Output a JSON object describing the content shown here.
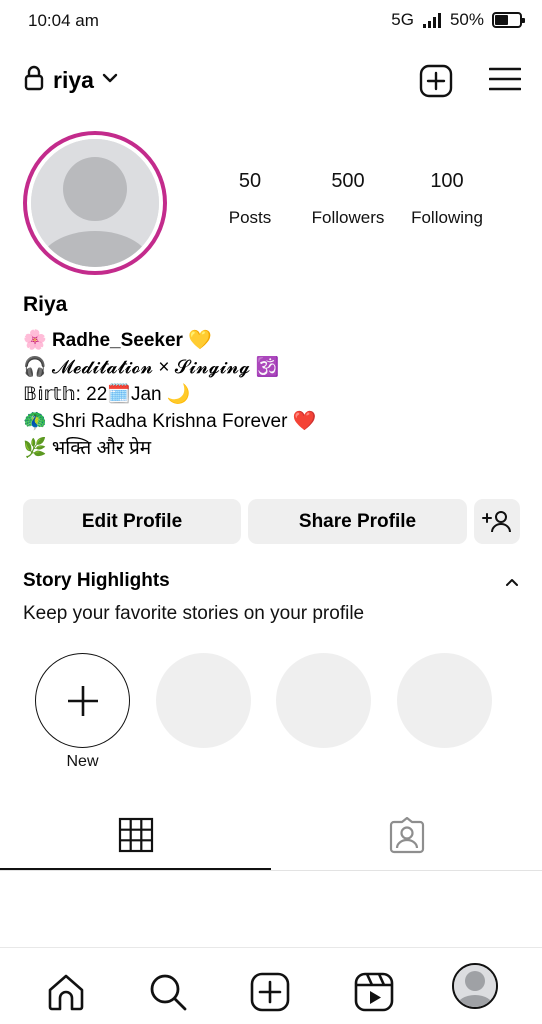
{
  "status_bar": {
    "time": "10:04 am",
    "network": "5G",
    "battery": "50%"
  },
  "header": {
    "username": "riya"
  },
  "profile": {
    "stats": [
      {
        "value": "50",
        "label": "Posts"
      },
      {
        "value": "500",
        "label": "Followers"
      },
      {
        "value": "100",
        "label": "Following"
      }
    ],
    "name": "Riya",
    "bio": {
      "line1_emoji": "🌸",
      "line1_text": "Radhe_Seeker",
      "line1_tail": "💛",
      "line2": "🎧 𝓜𝓮𝓭𝓲𝓽𝓪𝓽𝓲𝓸𝓷 × 𝓢𝓲𝓷𝓰𝓲𝓷𝓰 🕉️",
      "line3": "𝔹𝕚𝕣𝕥𝕙: 22🗓️Jan 🌙",
      "line4": "🦚 Shri Radha Krishna Forever ❤️",
      "line5": "🌿 भक्ति  और प्रेम"
    }
  },
  "actions": {
    "edit_label": "Edit Profile",
    "share_label": "Share Profile"
  },
  "highlights": {
    "title": "Story Highlights",
    "subtitle": "Keep your favorite stories on your profile",
    "new_label": "New"
  },
  "colors": {
    "story_ring": "#c32b8c",
    "button_bg": "#efefef",
    "placeholder": "#dcdde0"
  },
  "icons": {
    "top_bar": [
      "lock-icon",
      "chevron-down-icon",
      "create-post-icon",
      "menu-icon"
    ],
    "tabs": [
      "grid-icon",
      "tagged-icon"
    ],
    "bottom_nav": [
      "home-icon",
      "search-icon",
      "create-icon",
      "reels-icon",
      "profile-avatar"
    ]
  }
}
